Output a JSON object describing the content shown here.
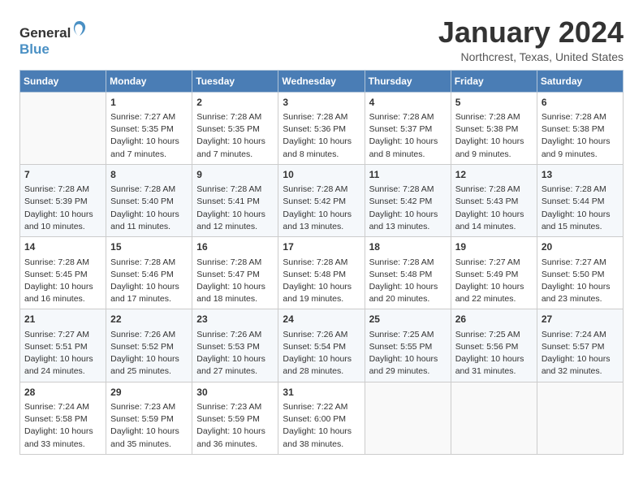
{
  "logo": {
    "general": "General",
    "blue": "Blue"
  },
  "title": "January 2024",
  "subtitle": "Northcrest, Texas, United States",
  "days_of_week": [
    "Sunday",
    "Monday",
    "Tuesday",
    "Wednesday",
    "Thursday",
    "Friday",
    "Saturday"
  ],
  "weeks": [
    [
      {
        "day": "",
        "content": ""
      },
      {
        "day": "1",
        "content": "Sunrise: 7:27 AM\nSunset: 5:35 PM\nDaylight: 10 hours\nand 7 minutes."
      },
      {
        "day": "2",
        "content": "Sunrise: 7:28 AM\nSunset: 5:35 PM\nDaylight: 10 hours\nand 7 minutes."
      },
      {
        "day": "3",
        "content": "Sunrise: 7:28 AM\nSunset: 5:36 PM\nDaylight: 10 hours\nand 8 minutes."
      },
      {
        "day": "4",
        "content": "Sunrise: 7:28 AM\nSunset: 5:37 PM\nDaylight: 10 hours\nand 8 minutes."
      },
      {
        "day": "5",
        "content": "Sunrise: 7:28 AM\nSunset: 5:38 PM\nDaylight: 10 hours\nand 9 minutes."
      },
      {
        "day": "6",
        "content": "Sunrise: 7:28 AM\nSunset: 5:38 PM\nDaylight: 10 hours\nand 9 minutes."
      }
    ],
    [
      {
        "day": "7",
        "content": "Sunrise: 7:28 AM\nSunset: 5:39 PM\nDaylight: 10 hours\nand 10 minutes."
      },
      {
        "day": "8",
        "content": "Sunrise: 7:28 AM\nSunset: 5:40 PM\nDaylight: 10 hours\nand 11 minutes."
      },
      {
        "day": "9",
        "content": "Sunrise: 7:28 AM\nSunset: 5:41 PM\nDaylight: 10 hours\nand 12 minutes."
      },
      {
        "day": "10",
        "content": "Sunrise: 7:28 AM\nSunset: 5:42 PM\nDaylight: 10 hours\nand 13 minutes."
      },
      {
        "day": "11",
        "content": "Sunrise: 7:28 AM\nSunset: 5:42 PM\nDaylight: 10 hours\nand 13 minutes."
      },
      {
        "day": "12",
        "content": "Sunrise: 7:28 AM\nSunset: 5:43 PM\nDaylight: 10 hours\nand 14 minutes."
      },
      {
        "day": "13",
        "content": "Sunrise: 7:28 AM\nSunset: 5:44 PM\nDaylight: 10 hours\nand 15 minutes."
      }
    ],
    [
      {
        "day": "14",
        "content": "Sunrise: 7:28 AM\nSunset: 5:45 PM\nDaylight: 10 hours\nand 16 minutes."
      },
      {
        "day": "15",
        "content": "Sunrise: 7:28 AM\nSunset: 5:46 PM\nDaylight: 10 hours\nand 17 minutes."
      },
      {
        "day": "16",
        "content": "Sunrise: 7:28 AM\nSunset: 5:47 PM\nDaylight: 10 hours\nand 18 minutes."
      },
      {
        "day": "17",
        "content": "Sunrise: 7:28 AM\nSunset: 5:48 PM\nDaylight: 10 hours\nand 19 minutes."
      },
      {
        "day": "18",
        "content": "Sunrise: 7:28 AM\nSunset: 5:48 PM\nDaylight: 10 hours\nand 20 minutes."
      },
      {
        "day": "19",
        "content": "Sunrise: 7:27 AM\nSunset: 5:49 PM\nDaylight: 10 hours\nand 22 minutes."
      },
      {
        "day": "20",
        "content": "Sunrise: 7:27 AM\nSunset: 5:50 PM\nDaylight: 10 hours\nand 23 minutes."
      }
    ],
    [
      {
        "day": "21",
        "content": "Sunrise: 7:27 AM\nSunset: 5:51 PM\nDaylight: 10 hours\nand 24 minutes."
      },
      {
        "day": "22",
        "content": "Sunrise: 7:26 AM\nSunset: 5:52 PM\nDaylight: 10 hours\nand 25 minutes."
      },
      {
        "day": "23",
        "content": "Sunrise: 7:26 AM\nSunset: 5:53 PM\nDaylight: 10 hours\nand 27 minutes."
      },
      {
        "day": "24",
        "content": "Sunrise: 7:26 AM\nSunset: 5:54 PM\nDaylight: 10 hours\nand 28 minutes."
      },
      {
        "day": "25",
        "content": "Sunrise: 7:25 AM\nSunset: 5:55 PM\nDaylight: 10 hours\nand 29 minutes."
      },
      {
        "day": "26",
        "content": "Sunrise: 7:25 AM\nSunset: 5:56 PM\nDaylight: 10 hours\nand 31 minutes."
      },
      {
        "day": "27",
        "content": "Sunrise: 7:24 AM\nSunset: 5:57 PM\nDaylight: 10 hours\nand 32 minutes."
      }
    ],
    [
      {
        "day": "28",
        "content": "Sunrise: 7:24 AM\nSunset: 5:58 PM\nDaylight: 10 hours\nand 33 minutes."
      },
      {
        "day": "29",
        "content": "Sunrise: 7:23 AM\nSunset: 5:59 PM\nDaylight: 10 hours\nand 35 minutes."
      },
      {
        "day": "30",
        "content": "Sunrise: 7:23 AM\nSunset: 5:59 PM\nDaylight: 10 hours\nand 36 minutes."
      },
      {
        "day": "31",
        "content": "Sunrise: 7:22 AM\nSunset: 6:00 PM\nDaylight: 10 hours\nand 38 minutes."
      },
      {
        "day": "",
        "content": ""
      },
      {
        "day": "",
        "content": ""
      },
      {
        "day": "",
        "content": ""
      }
    ]
  ]
}
